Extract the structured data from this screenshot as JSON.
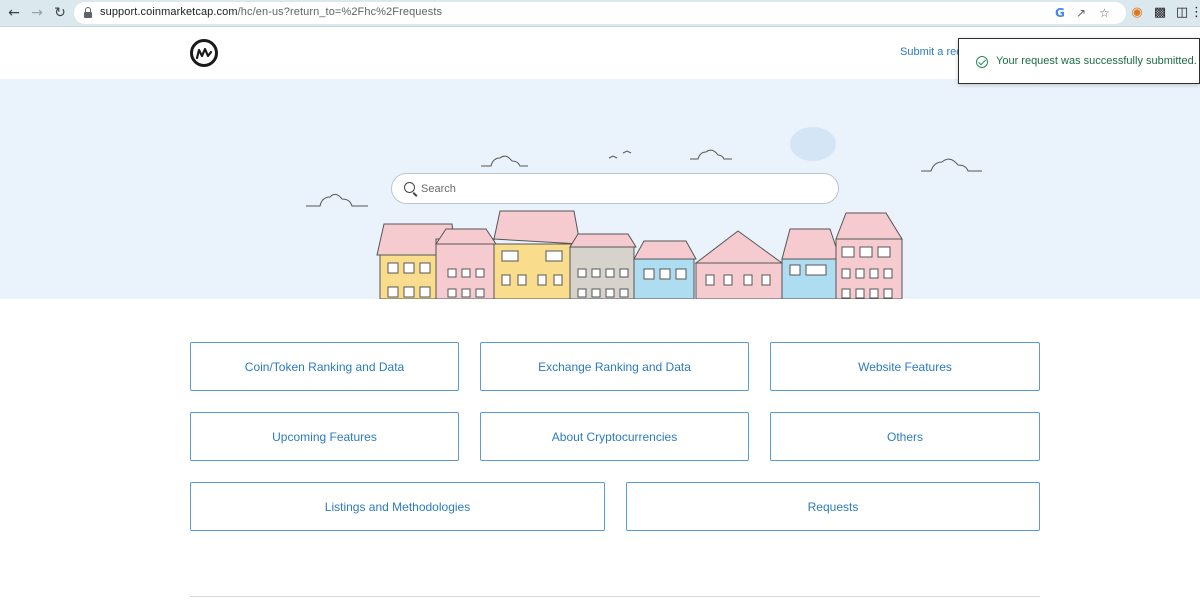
{
  "browser": {
    "back_icon": "arrow-left-icon",
    "forward_icon": "arrow-right-icon",
    "reload_icon": "reload-icon",
    "url_host": "support.coinmarketcap.com",
    "url_path": "/hc/en-us?return_to=%2Fhc%2Frequests",
    "address_icons": [
      "google-icon",
      "share-icon",
      "star-icon"
    ],
    "extension_icons": [
      "metamask-icon",
      "puzzle-icon",
      "sidepanel-icon",
      "more-icon"
    ]
  },
  "header": {
    "logo_icon": "coinmarketcap-logo-icon",
    "submit_link": "Submit a req"
  },
  "toast": {
    "message": "Your request was successfully submitted.",
    "icon": "check-circle-icon",
    "color": "#1d6b47"
  },
  "search": {
    "placeholder": "Search"
  },
  "categories": [
    {
      "label": "Coin/Token Ranking and Data"
    },
    {
      "label": "Exchange Ranking and Data"
    },
    {
      "label": "Website Features"
    },
    {
      "label": "Upcoming Features"
    },
    {
      "label": "About Cryptocurrencies"
    },
    {
      "label": "Others"
    },
    {
      "label": "Listings and Methodologies"
    },
    {
      "label": "Requests"
    }
  ],
  "colors": {
    "accent": "#2b7bbf",
    "border": "#5b9bd5",
    "hero_bg": "#eaf3fb"
  }
}
